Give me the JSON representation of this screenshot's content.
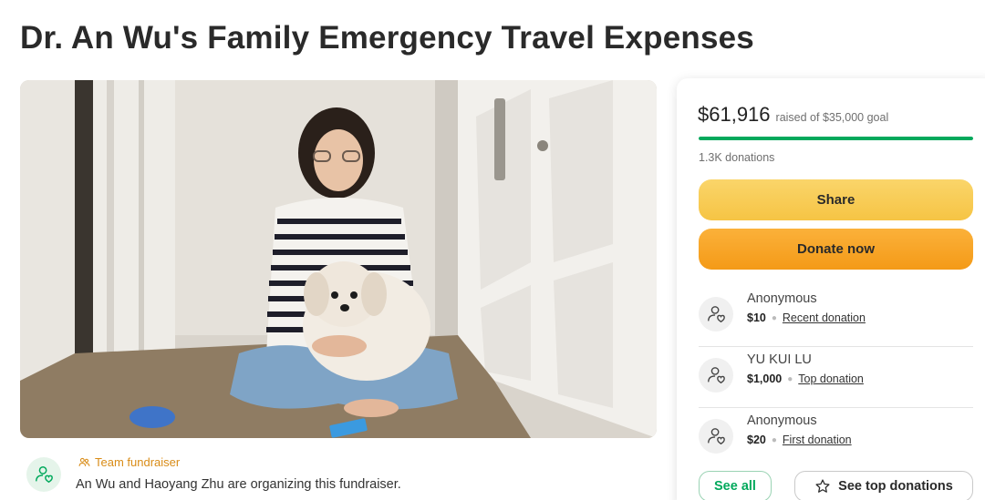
{
  "campaign": {
    "title": "Dr. An Wu's Family Emergency Travel Expenses"
  },
  "organizer": {
    "team_label": "Team fundraiser",
    "text": "An Wu and Haoyang Zhu are organizing this fundraiser."
  },
  "progress": {
    "raised": "$61,916",
    "goal_text": "raised of $35,000 goal",
    "fraction": 1.0,
    "donations_count": "1.3K donations"
  },
  "buttons": {
    "share": "Share",
    "donate": "Donate now",
    "see_all": "See all",
    "see_top": "See top donations"
  },
  "donations": [
    {
      "name": "Anonymous",
      "amount": "$10",
      "type": "Recent donation"
    },
    {
      "name": "YU KUI LU",
      "amount": "$1,000",
      "type": "Top donation"
    },
    {
      "name": "Anonymous",
      "amount": "$20",
      "type": "First donation"
    }
  ],
  "colors": {
    "accent_green": "#02a95c",
    "share_yellow": "#f6c444",
    "donate_orange": "#f49a17",
    "team_orange": "#d98c17"
  },
  "icons": {
    "organizer": "user-heart-icon",
    "team": "team-icon",
    "donor": "user-heart-icon",
    "star": "star-outline-icon"
  }
}
